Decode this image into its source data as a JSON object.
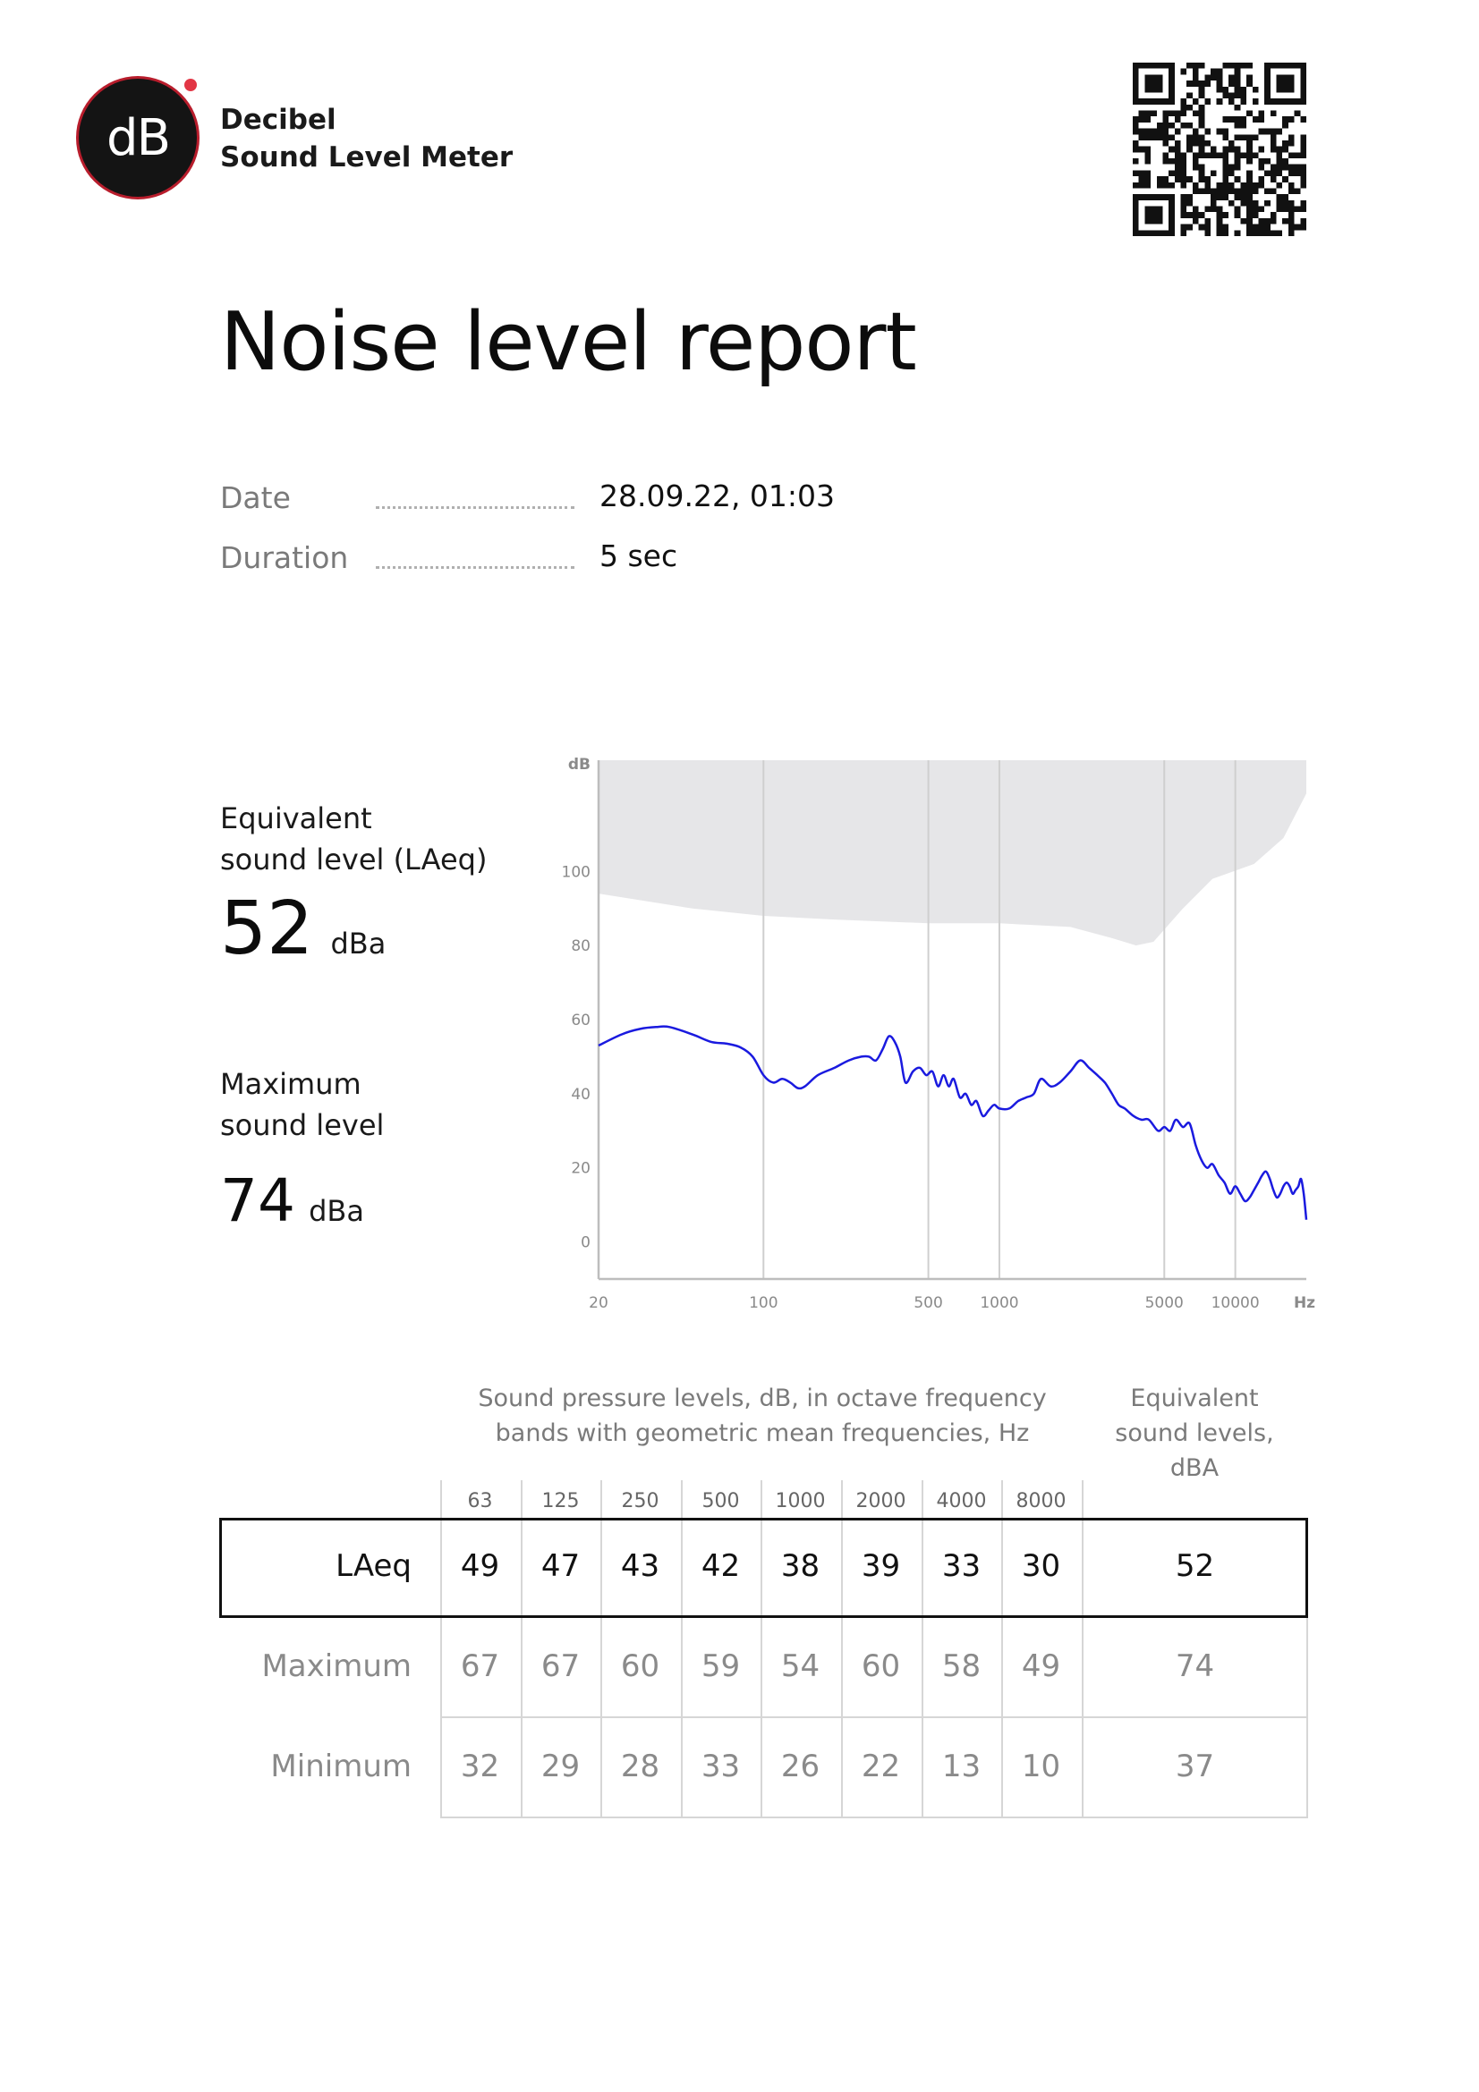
{
  "app": {
    "logo_text": "dB",
    "name_line1": "Decibel",
    "name_line2": "Sound Level Meter"
  },
  "report": {
    "title": "Noise level report",
    "date_label": "Date",
    "date_value": "28.09.22, 01:03",
    "duration_label": "Duration",
    "duration_value": "5 sec"
  },
  "metrics": {
    "laeq_label_line1": "Equivalent",
    "laeq_label_line2": "sound level (LAeq)",
    "laeq_value": "52",
    "laeq_unit": "dBa",
    "max_label_line1": "Maximum",
    "max_label_line2": "sound level",
    "max_value": "74",
    "max_unit": "dBa"
  },
  "colors": {
    "accent": "#e23645",
    "curve": "#1a1adf",
    "band": "#e6e6e8"
  },
  "chart_data": {
    "type": "line",
    "xscale": "log",
    "ylabel": "dB",
    "xlabel": "Hz",
    "xlim": [
      20,
      20000
    ],
    "ylim": [
      -10,
      130
    ],
    "x_ticks": [
      20,
      100,
      500,
      1000,
      5000,
      10000
    ],
    "x_tick_labels": [
      "20",
      "100",
      "500",
      "1000",
      "5000",
      "10000"
    ],
    "y_ticks": [
      0,
      20,
      40,
      60,
      80,
      100
    ],
    "grid_x": [
      100,
      500,
      1000,
      5000,
      10000
    ],
    "band_lower": {
      "x": [
        20,
        50,
        100,
        200,
        500,
        1000,
        2000,
        3000,
        3800,
        4500,
        6000,
        8000,
        12000,
        16000,
        20000
      ],
      "y": [
        94,
        90,
        88,
        87,
        86,
        86,
        85,
        82,
        80,
        81,
        90,
        98,
        102,
        109,
        121
      ]
    },
    "series": [
      {
        "x": [
          20,
          25,
          30,
          35,
          40,
          50,
          60,
          70,
          80,
          90,
          100,
          110,
          120,
          130,
          140,
          150,
          170,
          200,
          230,
          260,
          280,
          300,
          320,
          340,
          360,
          380,
          400,
          430,
          460,
          490,
          520,
          550,
          580,
          610,
          640,
          680,
          720,
          760,
          800,
          850,
          900,
          950,
          1000,
          1100,
          1200,
          1300,
          1400,
          1500,
          1650,
          1800,
          2000,
          2200,
          2400,
          2600,
          2800,
          3000,
          3200,
          3400,
          3700,
          4000,
          4300,
          4700,
          5000,
          5300,
          5600,
          6000,
          6400,
          6800,
          7200,
          7600,
          8000,
          8500,
          9000,
          9500,
          10000,
          10500,
          11000,
          11500,
          12000,
          12500,
          13000,
          13500,
          14000,
          14500,
          15000,
          15500,
          16000,
          16500,
          17000,
          17500,
          18000,
          18500,
          19000,
          19500,
          20000
        ],
        "y": [
          53,
          56,
          57.5,
          58,
          58,
          56,
          54,
          53.5,
          52.5,
          50,
          45,
          43,
          44,
          43,
          41.5,
          42,
          45,
          47,
          49,
          50,
          50,
          49,
          52,
          55.5,
          54,
          50,
          43,
          46,
          47,
          45,
          46,
          42,
          45,
          42,
          44,
          39,
          40,
          37,
          38,
          34,
          35.5,
          37,
          36,
          36,
          38,
          39,
          40,
          44,
          42,
          43,
          46,
          49,
          47,
          45,
          43,
          40,
          37,
          36,
          34,
          33,
          33,
          30,
          31,
          30,
          33,
          31,
          32,
          26,
          22,
          20,
          21,
          18,
          16,
          13,
          15,
          13,
          11,
          12,
          14,
          16,
          18,
          19,
          17,
          14,
          12,
          13,
          15,
          16,
          15,
          13,
          14,
          15,
          17,
          13,
          6
        ]
      }
    ]
  },
  "table": {
    "caption_line1": "Sound pressure levels, dB, in octave frequency",
    "caption_line2": "bands with geometric mean frequencies, Hz",
    "eq_caption_line1": "Equivalent",
    "eq_caption_line2": "sound levels,",
    "eq_caption_line3": "dBA",
    "freqs": [
      "63",
      "125",
      "250",
      "500",
      "1000",
      "2000",
      "4000",
      "8000"
    ],
    "rows": [
      {
        "label": "LAeq",
        "values": [
          "49",
          "47",
          "43",
          "42",
          "38",
          "39",
          "33",
          "30"
        ],
        "total": "52"
      },
      {
        "label": "Maximum",
        "values": [
          "67",
          "67",
          "60",
          "59",
          "54",
          "60",
          "58",
          "49"
        ],
        "total": "74"
      },
      {
        "label": "Minimum",
        "values": [
          "32",
          "29",
          "28",
          "33",
          "26",
          "22",
          "13",
          "10"
        ],
        "total": "37"
      }
    ]
  }
}
